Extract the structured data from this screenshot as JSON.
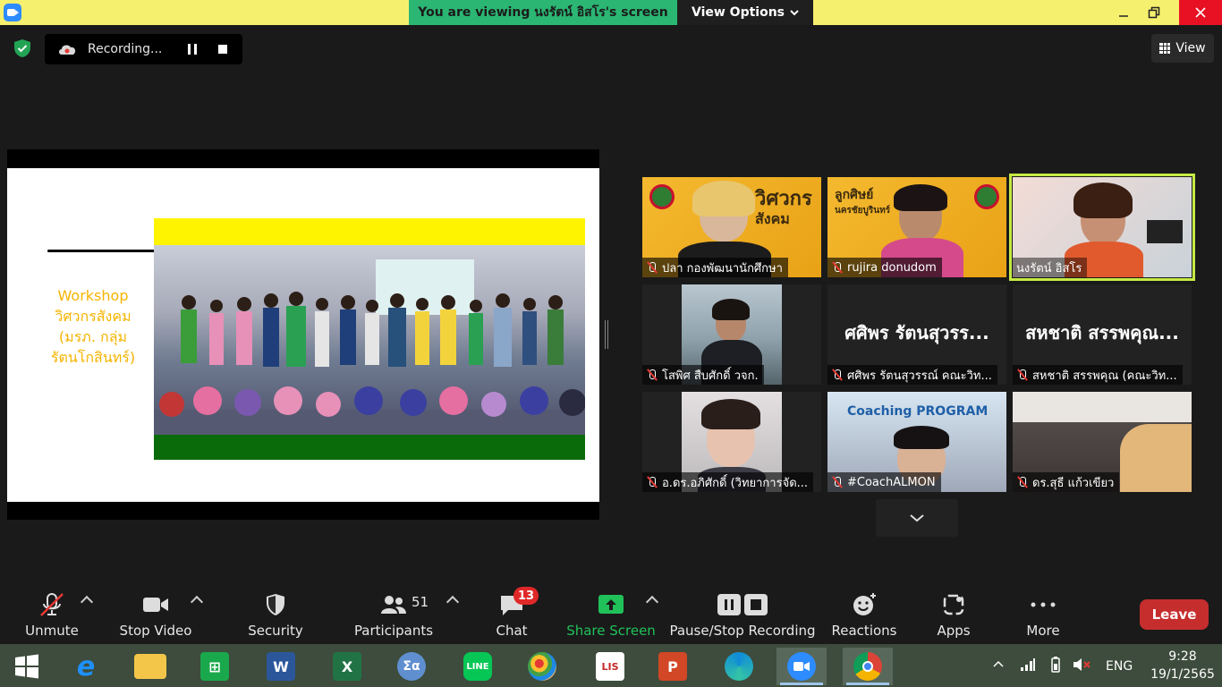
{
  "titlebar": {
    "banner": "You are viewing นงรัตน์ อิสโร's screen",
    "view_options": "View Options"
  },
  "toolbar": {
    "recording_label": "Recording...",
    "view_label": "View"
  },
  "slide": {
    "workshop_lines": [
      "Workshop",
      "วิศวกรสังคม",
      "(มรภ. กลุ่ม",
      "รัตนโกสินทร์)"
    ]
  },
  "gallery": {
    "tiles": [
      {
        "name": "ปลา กองพัฒนานักศึกษา",
        "video": true,
        "active": false
      },
      {
        "name": "rujira donudom",
        "video": true,
        "active": false
      },
      {
        "name": "นงรัตน์ อิสโร",
        "video": true,
        "active": true
      },
      {
        "name": "โสพิศ สืบศักดิ์ วจก.",
        "video": true,
        "active": false
      },
      {
        "name": "ศศิพร รัตนสุวรรณ์ คณะวิท...",
        "video": false,
        "big_name": "ศศิพร รัตนสุวรร...",
        "active": false
      },
      {
        "name": "สหชาติ สรรพคุณ (คณะวิท...",
        "video": false,
        "big_name": "สหชาติ สรรพคุณ...",
        "active": false
      },
      {
        "name": "อ.ดร.อภิศักดิ์ (วิทยาการจัด...",
        "video": true,
        "active": false
      },
      {
        "name": "#CoachALMON",
        "video": true,
        "active": false
      },
      {
        "name": "ดร.สุธี แก้วเขียว",
        "video": true,
        "active": false
      }
    ],
    "tile_texts": {
      "gold1_title": [
        "วิศวกร",
        "สังคม"
      ],
      "gold2_title": [
        "ลูกศิษย์",
        "นครชัยบูรินทร์"
      ],
      "coach_banner": "Coaching PROGRAM"
    }
  },
  "controls": {
    "unmute": "Unmute",
    "stop_video": "Stop Video",
    "security": "Security",
    "participants": "Participants",
    "participants_count": "51",
    "chat": "Chat",
    "chat_badge": "13",
    "share_screen": "Share Screen",
    "pause_stop_recording": "Pause/Stop Recording",
    "reactions": "Reactions",
    "apps": "Apps",
    "more": "More",
    "leave": "Leave"
  },
  "taskbar": {
    "language": "ENG",
    "time": "9:28",
    "date": "19/1/2565",
    "apps": [
      "start",
      "internet-explorer",
      "file-explorer",
      "microsoft-store",
      "word",
      "excel",
      "calculator",
      "line",
      "paint",
      "lisrel",
      "powerpoint",
      "edge",
      "zoom",
      "chrome"
    ]
  },
  "colors": {
    "titlebar": "#f6f06f",
    "banner": "#2bb673",
    "share_green": "#21c15a",
    "leave": "#c62d2d",
    "active_speaker": "#c6ea44",
    "slide_text": "#f5b400"
  }
}
